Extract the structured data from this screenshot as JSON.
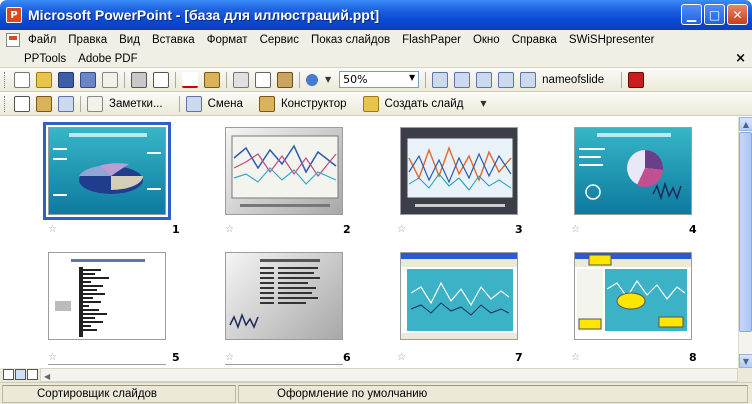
{
  "window": {
    "title": "Microsoft PowerPoint - [база для иллюстраций.ppt]",
    "app_icon": "P"
  },
  "menu": {
    "items": [
      "Файл",
      "Правка",
      "Вид",
      "Вставка",
      "Формат",
      "Сервис",
      "Показ слайдов",
      "FlashPaper",
      "Окно",
      "Справка",
      "SWiSHpresenter"
    ],
    "row2": [
      "PPTools",
      "Adobe PDF"
    ],
    "close_glyph": "×"
  },
  "toolbar1": {
    "zoom": "50%",
    "nameofslide": "nameofslide"
  },
  "toolbar2": {
    "notes": "Заметки...",
    "transition": "Смена",
    "designer": "Конструктор",
    "new_slide": "Создать слайд"
  },
  "slides": [
    {
      "num": "1",
      "kind": "pie3d",
      "selected": true
    },
    {
      "num": "2",
      "kind": "lines-gray"
    },
    {
      "num": "3",
      "kind": "lines-dark"
    },
    {
      "num": "4",
      "kind": "pie-teal"
    },
    {
      "num": "5",
      "kind": "barlist"
    },
    {
      "num": "6",
      "kind": "text-gray"
    },
    {
      "num": "7",
      "kind": "screenshot"
    },
    {
      "num": "8",
      "kind": "screenshot-callouts"
    }
  ],
  "status": {
    "view": "Сортировщик слайдов",
    "design": "Оформление по умолчанию"
  },
  "colors": {
    "titlebar": "#0a49d2",
    "selection": "#2f5fc8",
    "slide_teal": "#0d7aa0"
  }
}
